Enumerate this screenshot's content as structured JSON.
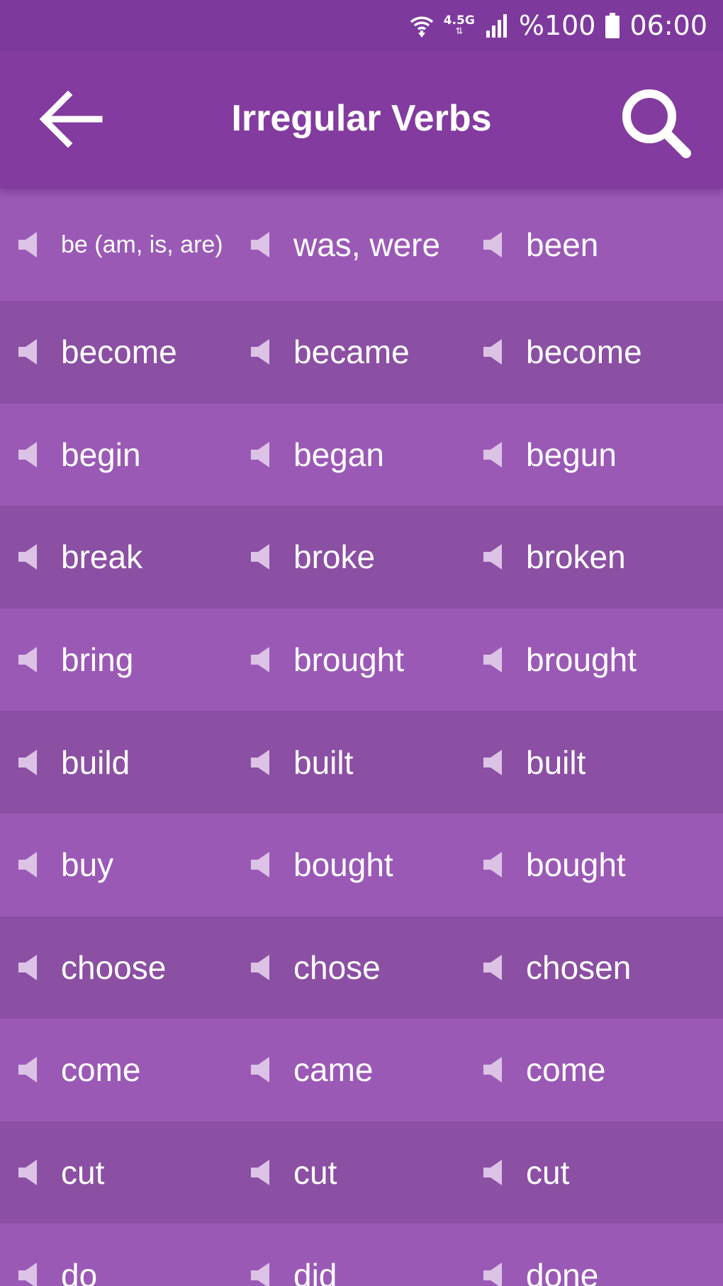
{
  "status": {
    "network_type": "4.5G",
    "battery": "%100",
    "time": "06:00"
  },
  "app_bar": {
    "title": "Irregular Verbs"
  },
  "colors": {
    "status_bar": "#7e399d",
    "app_bar": "#833b9f",
    "row_light": "#9b59b6",
    "row_dark": "#8b4fa3",
    "speaker_icon": "#dcc3e6"
  },
  "icons": {
    "back": "arrow-left-icon",
    "search": "search-icon",
    "speaker": "speaker-icon"
  },
  "verbs": [
    [
      "be (am, is, are)",
      "was, were",
      "been"
    ],
    [
      "become",
      "became",
      "become"
    ],
    [
      "begin",
      "began",
      "begun"
    ],
    [
      "break",
      "broke",
      "broken"
    ],
    [
      "bring",
      "brought",
      "brought"
    ],
    [
      "build",
      "built",
      "built"
    ],
    [
      "buy",
      "bought",
      "bought"
    ],
    [
      "choose",
      "chose",
      "chosen"
    ],
    [
      "come",
      "came",
      "come"
    ],
    [
      "cut",
      "cut",
      "cut"
    ],
    [
      "do",
      "did",
      "done"
    ]
  ]
}
